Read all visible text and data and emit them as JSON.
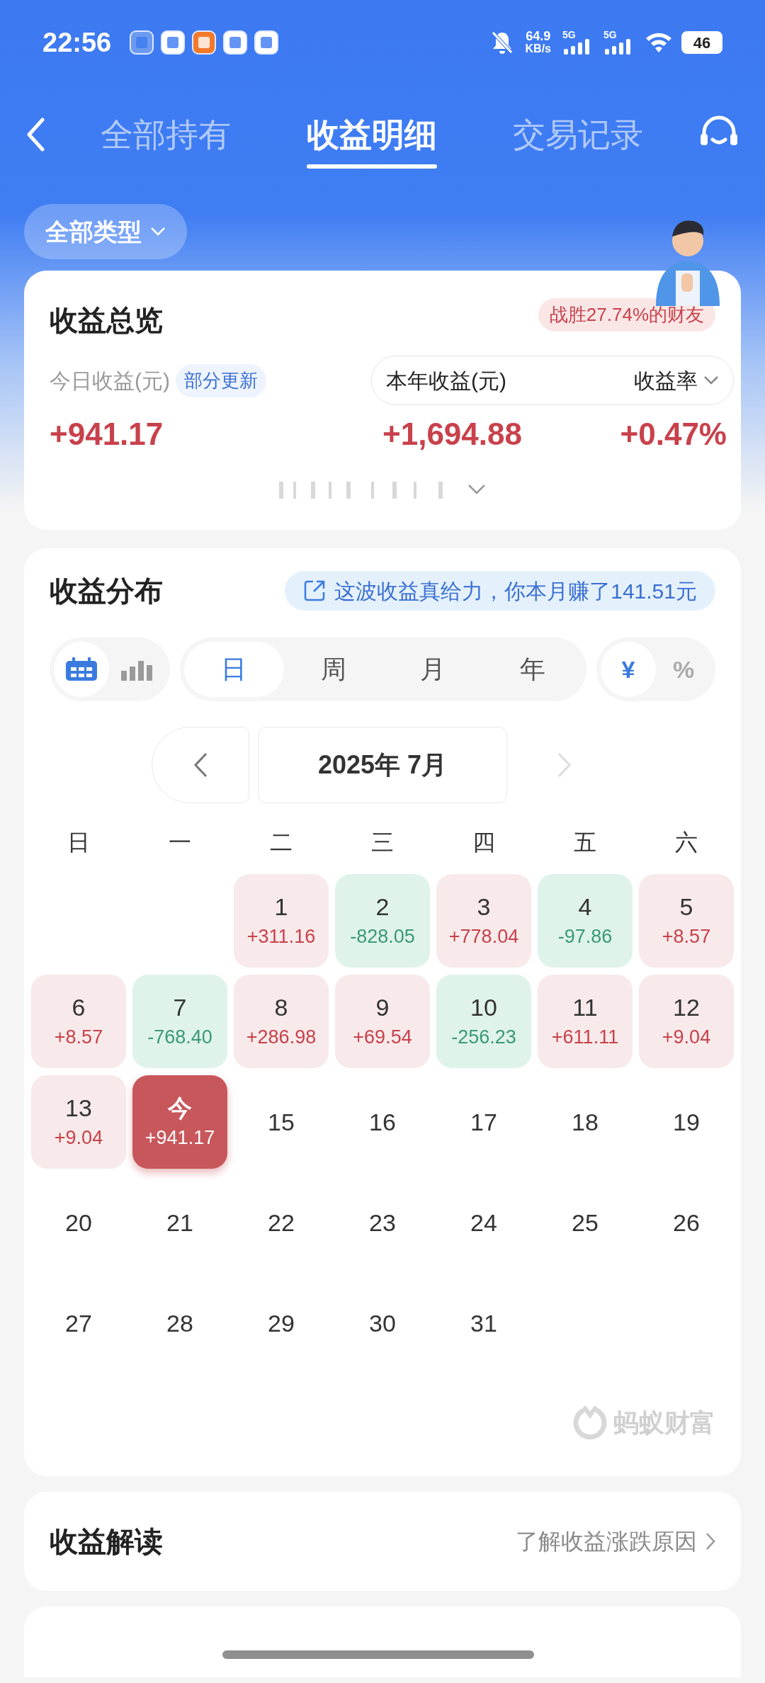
{
  "status_bar": {
    "time": "22:56",
    "speed_value": "64.9",
    "speed_unit": "KB/s",
    "sim_labels": [
      "5G",
      "5G"
    ],
    "battery": "46"
  },
  "tabs": [
    {
      "label": "全部持有",
      "selected": false
    },
    {
      "label": "收益明细",
      "selected": true
    },
    {
      "label": "交易记录",
      "selected": false
    }
  ],
  "filter": {
    "label": "全部类型"
  },
  "overview": {
    "title": "收益总览",
    "rank_badge": "战胜27.74%的财友",
    "today_label": "今日收益(元)",
    "update_tag": "部分更新",
    "today_value": "+941.17",
    "year_label": "本年收益(元)",
    "rate_label": "收益率",
    "year_value": "+1,694.88",
    "rate_value": "+0.47%"
  },
  "distribution": {
    "title": "收益分布",
    "banner": "这波收益真给力，你本月赚了141.51元",
    "view_toggle": [
      {
        "kind": "calendar",
        "selected": true
      },
      {
        "kind": "bars",
        "selected": false
      }
    ],
    "periods": [
      {
        "label": "日",
        "selected": true
      },
      {
        "label": "周",
        "selected": false
      },
      {
        "label": "月",
        "selected": false
      },
      {
        "label": "年",
        "selected": false
      }
    ],
    "units": [
      {
        "label": "¥",
        "selected": true
      },
      {
        "label": "%",
        "selected": false
      }
    ],
    "month": "2025年 7月",
    "weekdays": [
      "日",
      "一",
      "二",
      "三",
      "四",
      "五",
      "六"
    ],
    "weeks": [
      [
        {
          "kind": "blank"
        },
        {
          "kind": "blank"
        },
        {
          "kind": "gain",
          "day": "1",
          "value": "+311.16"
        },
        {
          "kind": "loss",
          "day": "2",
          "value": "-828.05"
        },
        {
          "kind": "gain",
          "day": "3",
          "value": "+778.04"
        },
        {
          "kind": "loss",
          "day": "4",
          "value": "-97.86"
        },
        {
          "kind": "gain",
          "day": "5",
          "value": "+8.57"
        }
      ],
      [
        {
          "kind": "gain",
          "day": "6",
          "value": "+8.57"
        },
        {
          "kind": "loss",
          "day": "7",
          "value": "-768.40"
        },
        {
          "kind": "gain",
          "day": "8",
          "value": "+286.98"
        },
        {
          "kind": "gain",
          "day": "9",
          "value": "+69.54"
        },
        {
          "kind": "loss",
          "day": "10",
          "value": "-256.23"
        },
        {
          "kind": "gain",
          "day": "11",
          "value": "+611.11"
        },
        {
          "kind": "gain",
          "day": "12",
          "value": "+9.04"
        }
      ],
      [
        {
          "kind": "gain",
          "day": "13",
          "value": "+9.04"
        },
        {
          "kind": "today",
          "day": "今",
          "value": "+941.17"
        },
        {
          "kind": "plain",
          "day": "15"
        },
        {
          "kind": "plain",
          "day": "16"
        },
        {
          "kind": "plain",
          "day": "17"
        },
        {
          "kind": "plain",
          "day": "18"
        },
        {
          "kind": "plain",
          "day": "19"
        }
      ],
      [
        {
          "kind": "plain",
          "day": "20"
        },
        {
          "kind": "plain",
          "day": "21"
        },
        {
          "kind": "plain",
          "day": "22"
        },
        {
          "kind": "plain",
          "day": "23"
        },
        {
          "kind": "plain",
          "day": "24"
        },
        {
          "kind": "plain",
          "day": "25"
        },
        {
          "kind": "plain",
          "day": "26"
        }
      ],
      [
        {
          "kind": "plain",
          "day": "27"
        },
        {
          "kind": "plain",
          "day": "28"
        },
        {
          "kind": "plain",
          "day": "29"
        },
        {
          "kind": "plain",
          "day": "30"
        },
        {
          "kind": "plain",
          "day": "31"
        }
      ]
    ],
    "brand": "蚂蚁财富"
  },
  "interpretation": {
    "title": "收益解读",
    "link": "了解收益涨跌原因"
  }
}
